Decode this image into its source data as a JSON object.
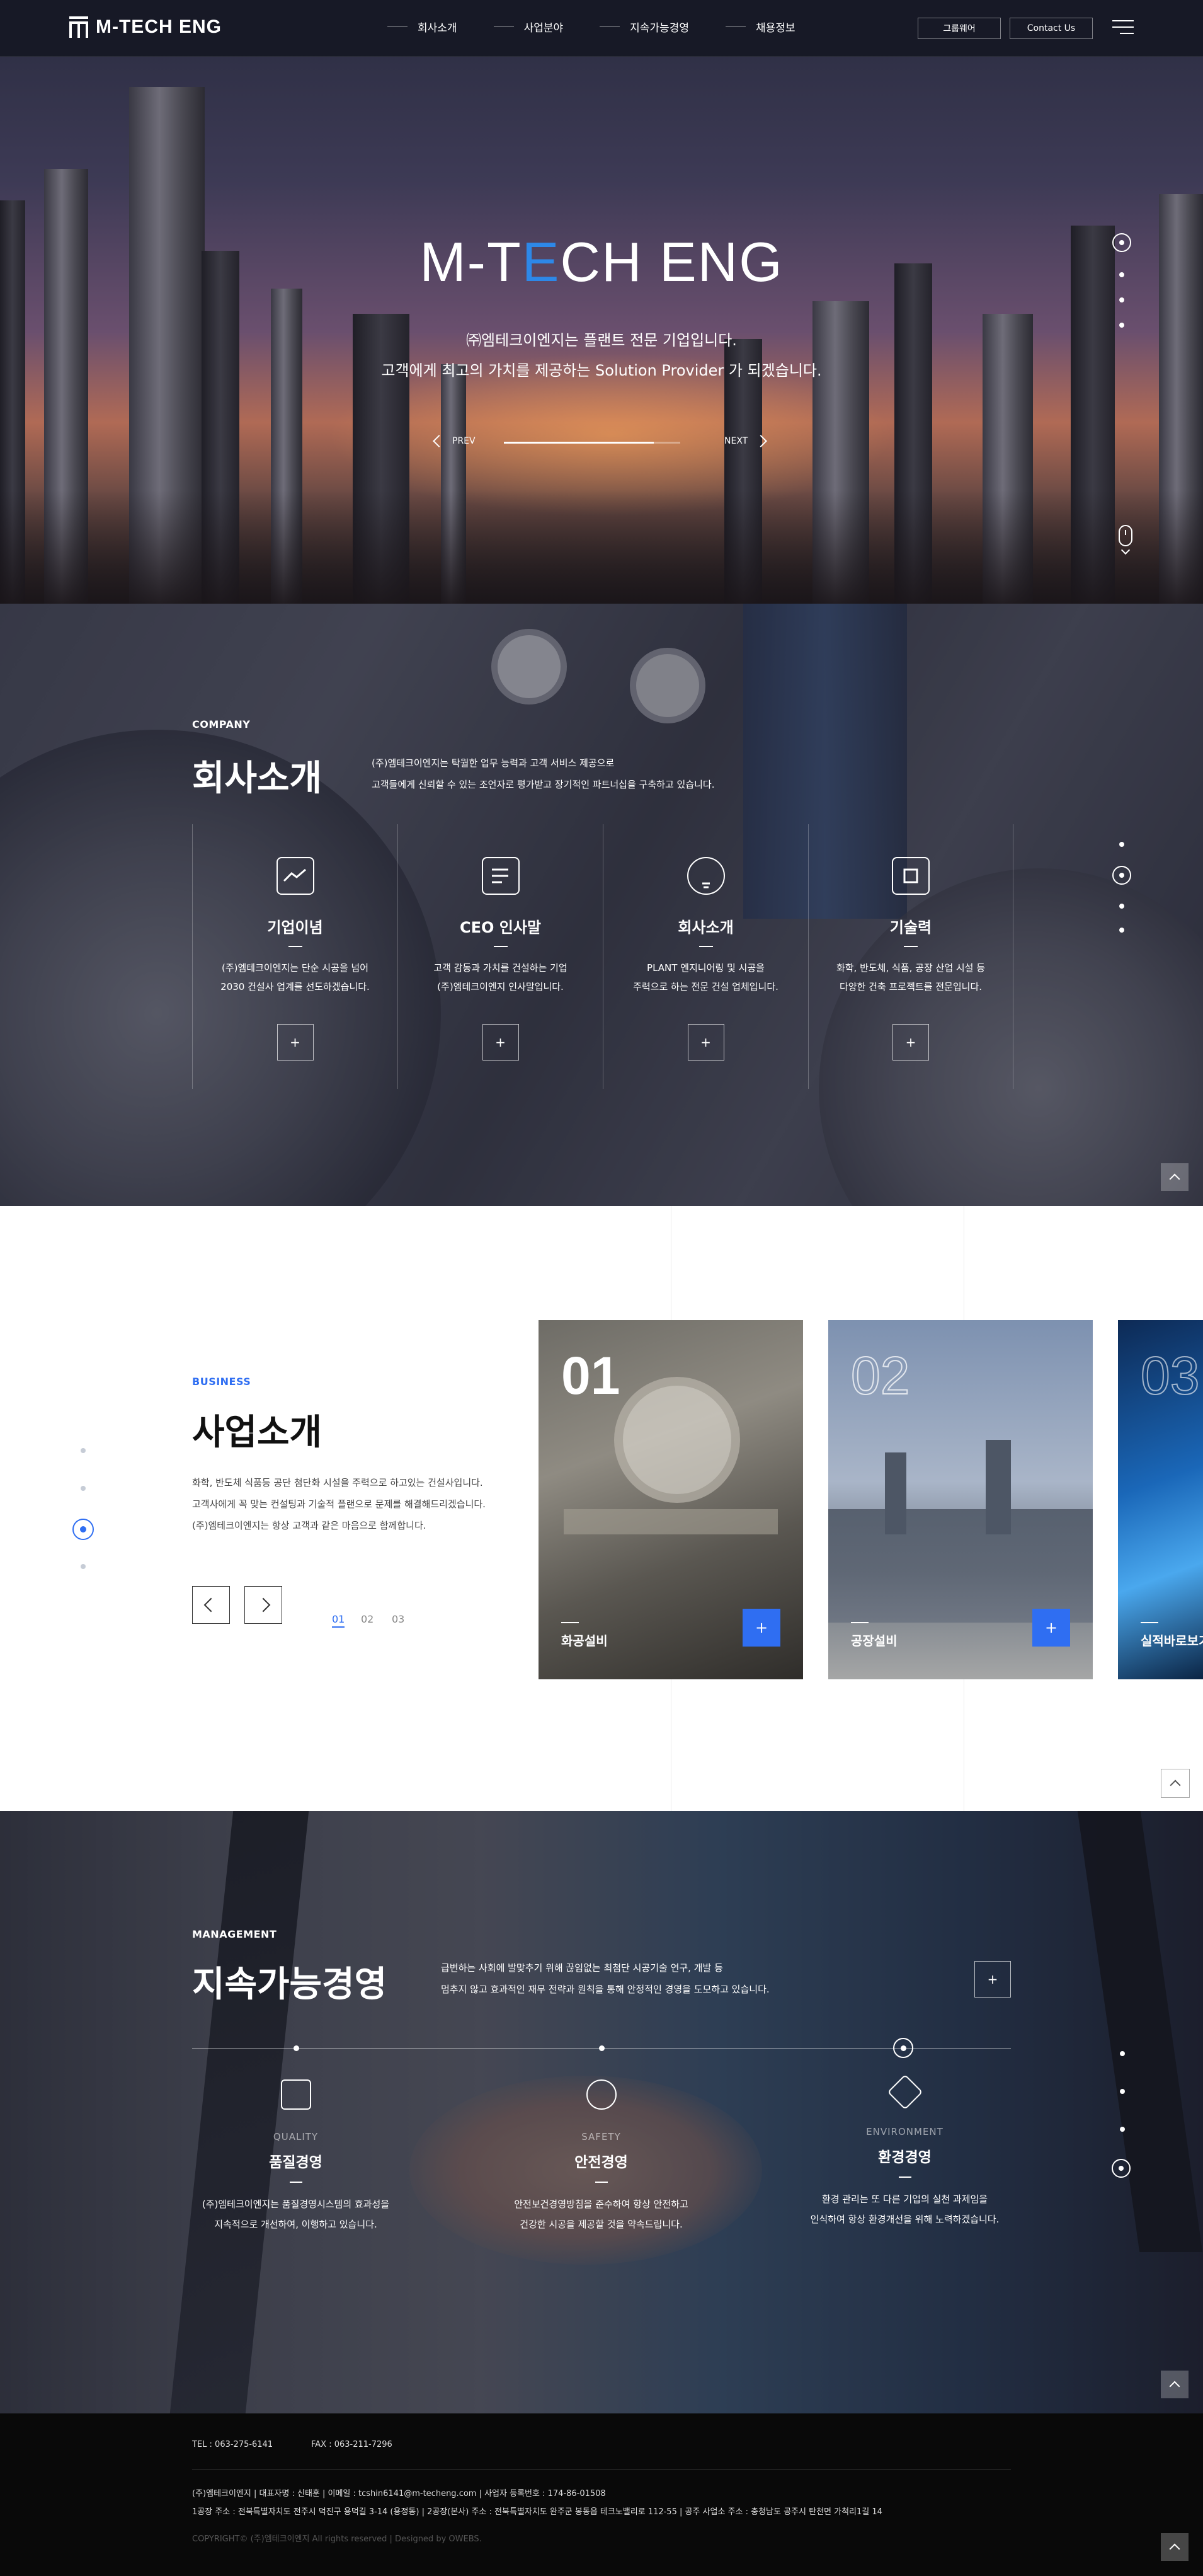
{
  "header": {
    "logo_text": "M-TECH ENG",
    "nav": [
      "회사소개",
      "사업분야",
      "지속가능경영",
      "채용정보"
    ],
    "group_label": "그룹웨어",
    "contact_label": "Contact Us"
  },
  "hero": {
    "title_pre": "M-T",
    "title_accent": "E",
    "title_post": "CH ENG",
    "line1": "㈜엠테크이엔지는 플랜트 전문 기업입니다.",
    "line2": "고객에게 최고의 가치를 제공하는 Solution Provider 가 되겠습니다.",
    "prev_label": "PREV",
    "next_label": "NEXT",
    "progress": 0.85
  },
  "company": {
    "eyebrow": "COMPANY",
    "title": "회사소개",
    "desc1": "(주)엠테크이엔지는 탁월한 업무 능력과 고객 서비스 제공으로",
    "desc2": "고객들에게 신뢰할 수 있는 조언자로 평가받고 장기적인 파트너십을 구축하고 있습니다.",
    "items": [
      {
        "title": "기업이념",
        "line1": "(주)엠테크이엔지는 단순 시공을 넘어",
        "line2": "2030 건설사 업계를 선도하겠습니다.",
        "icon": "handshake-icon"
      },
      {
        "title": "CEO 인사말",
        "line1": "고객 감동과 가치를 건설하는 기업",
        "line2": "(주)엠테크이엔지 인사말입니다.",
        "icon": "document-pen-icon"
      },
      {
        "title": "회사소개",
        "line1": "PLANT 엔지니어링 및 시공을",
        "line2": "주력으로 하는 전문 건설 업체입니다.",
        "icon": "lightbulb-icon"
      },
      {
        "title": "기술력",
        "line1": "화학, 반도체, 식품, 공장 산업 시설 등",
        "line2": "다양한 건축 프로젝트를 전문입니다.",
        "icon": "chip-icon"
      }
    ],
    "plus_label": "+"
  },
  "business": {
    "eyebrow": "BUSINESS",
    "title": "사업소개",
    "desc1": "화학, 반도체 식품등 공단 첨단화 시설을 주력으로 하고있는 건설사입니다.",
    "desc2": "고객사에게 꼭 맞는 컨설팅과 기술적 플랜으로 문제를 해결해드리겠습니다.",
    "desc3": "(주)엠테크이엔지는 항상 고객과 같은 마음으로 함께합니다.",
    "pages": [
      "01",
      "02",
      "03"
    ],
    "cards": [
      {
        "num": "01",
        "caption": "화공설비",
        "plus": "+"
      },
      {
        "num": "02",
        "caption": "공장설비",
        "plus": "+"
      },
      {
        "num": "03",
        "caption": "실적바로보기"
      }
    ]
  },
  "management": {
    "eyebrow": "MANAGEMENT",
    "title": "지속가능경영",
    "desc1": "급변하는 사회에 발맞추기 위해 끊임없는 최첨단 시공기술 연구, 개발 등",
    "desc2": "멈추지 않고 효과적인 재무 전략과 원칙을 통해 안정적인 경영을 도모하고 있습니다.",
    "plus_label": "+",
    "items": [
      {
        "eng": "QUALITY",
        "title": "품질경영",
        "line1": "(주)엠테크이엔지는 품질경영시스템의 효과성을",
        "line2": "지속적으로 개선하여, 이행하고 있습니다.",
        "icon": "certificate-icon"
      },
      {
        "eng": "SAFETY",
        "title": "안전경영",
        "line1": "안전보건경영방침을 준수하여 항상 안전하고",
        "line2": "건강한 시공을 제공할 것을 약속드립니다.",
        "icon": "hands-heart-icon"
      },
      {
        "eng": "ENVIRONMENT",
        "title": "환경경영",
        "line1": "환경 관리는 또 다른 기업의 실천 과제임을",
        "line2": "인식하여 항상 환경개선을 위해 노력하겠습니다.",
        "icon": "network-icon"
      }
    ]
  },
  "footer": {
    "tel": "TEL : 063-275-6141",
    "fax": "FAX : 063-211-7296",
    "info1": "(주)엠테크이엔지  |  대표자명 : 신태훈  |  이메일 : tcshin6141@m-techeng.com  |  사업자 등록번호 : 174-86-01508",
    "info2": "1공장 주소 : 전북특별자치도 전주시 덕진구 용덕길 3-14 (용정동)  |  2공장(본사) 주소 : 전북특별자치도 완주군 봉동읍 테크노밸리로 112-55  |  공주 사업소 주소 : 충청남도 공주시 탄천면 가척리1길 14",
    "copyright": "COPYRIGHT© (주)엠테크이엔지 All rights reserved  |  Designed by OWEBS."
  }
}
